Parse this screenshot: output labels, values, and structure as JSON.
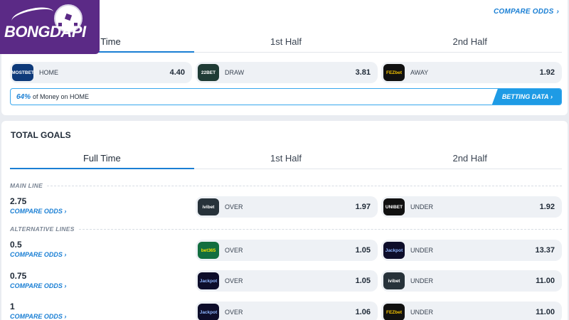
{
  "brand": {
    "name": "BONGDAPI"
  },
  "match_odds": {
    "compare_label": "COMPARE ODDS",
    "tabs": [
      "Full Time",
      "1st Half",
      "2nd Half"
    ],
    "outcomes": [
      {
        "bookmaker": "MOSTBET",
        "label": "HOME",
        "odds": "4.40",
        "color": "#0e3a7a"
      },
      {
        "bookmaker": "22BET",
        "label": "DRAW",
        "odds": "3.81",
        "color": "#1f3b35"
      },
      {
        "bookmaker": "FEZbet",
        "label": "AWAY",
        "odds": "1.92",
        "color": "#111111"
      }
    ],
    "money": {
      "percent": "64%",
      "text": "of Money on HOME",
      "button": "BETTING DATA"
    }
  },
  "total_goals": {
    "title": "TOTAL GOALS",
    "tabs": [
      "Full Time",
      "1st Half",
      "2nd Half"
    ],
    "main_line_label": "MAIN LINE",
    "alt_lines_label": "ALTERNATIVE LINES",
    "compare_label": "COMPARE ODDS",
    "lines": [
      {
        "line": "2.75",
        "over_bm": "ivibet",
        "over_color": "#27323a",
        "over_label": "OVER",
        "over": "1.97",
        "under_bm": "UNIBET",
        "under_color": "#111111",
        "under_label": "UNDER",
        "under": "1.92"
      },
      {
        "line": "0.5",
        "over_bm": "bet365",
        "over_color": "#126e3f",
        "over_label": "OVER",
        "over": "1.05",
        "under_bm": "Jackpot",
        "under_color": "#0d0d2a",
        "under_label": "UNDER",
        "under": "13.37"
      },
      {
        "line": "0.75",
        "over_bm": "Jackpot",
        "over_color": "#0d0d2a",
        "over_label": "OVER",
        "over": "1.05",
        "under_bm": "ivibet",
        "under_color": "#27323a",
        "under_label": "UNDER",
        "under": "11.00"
      },
      {
        "line": "1",
        "over_bm": "Jackpot",
        "over_color": "#0d0d2a",
        "over_label": "OVER",
        "over": "1.06",
        "under_bm": "FEZbet",
        "under_color": "#111111",
        "under_label": "UNDER",
        "under": "11.00"
      }
    ]
  }
}
